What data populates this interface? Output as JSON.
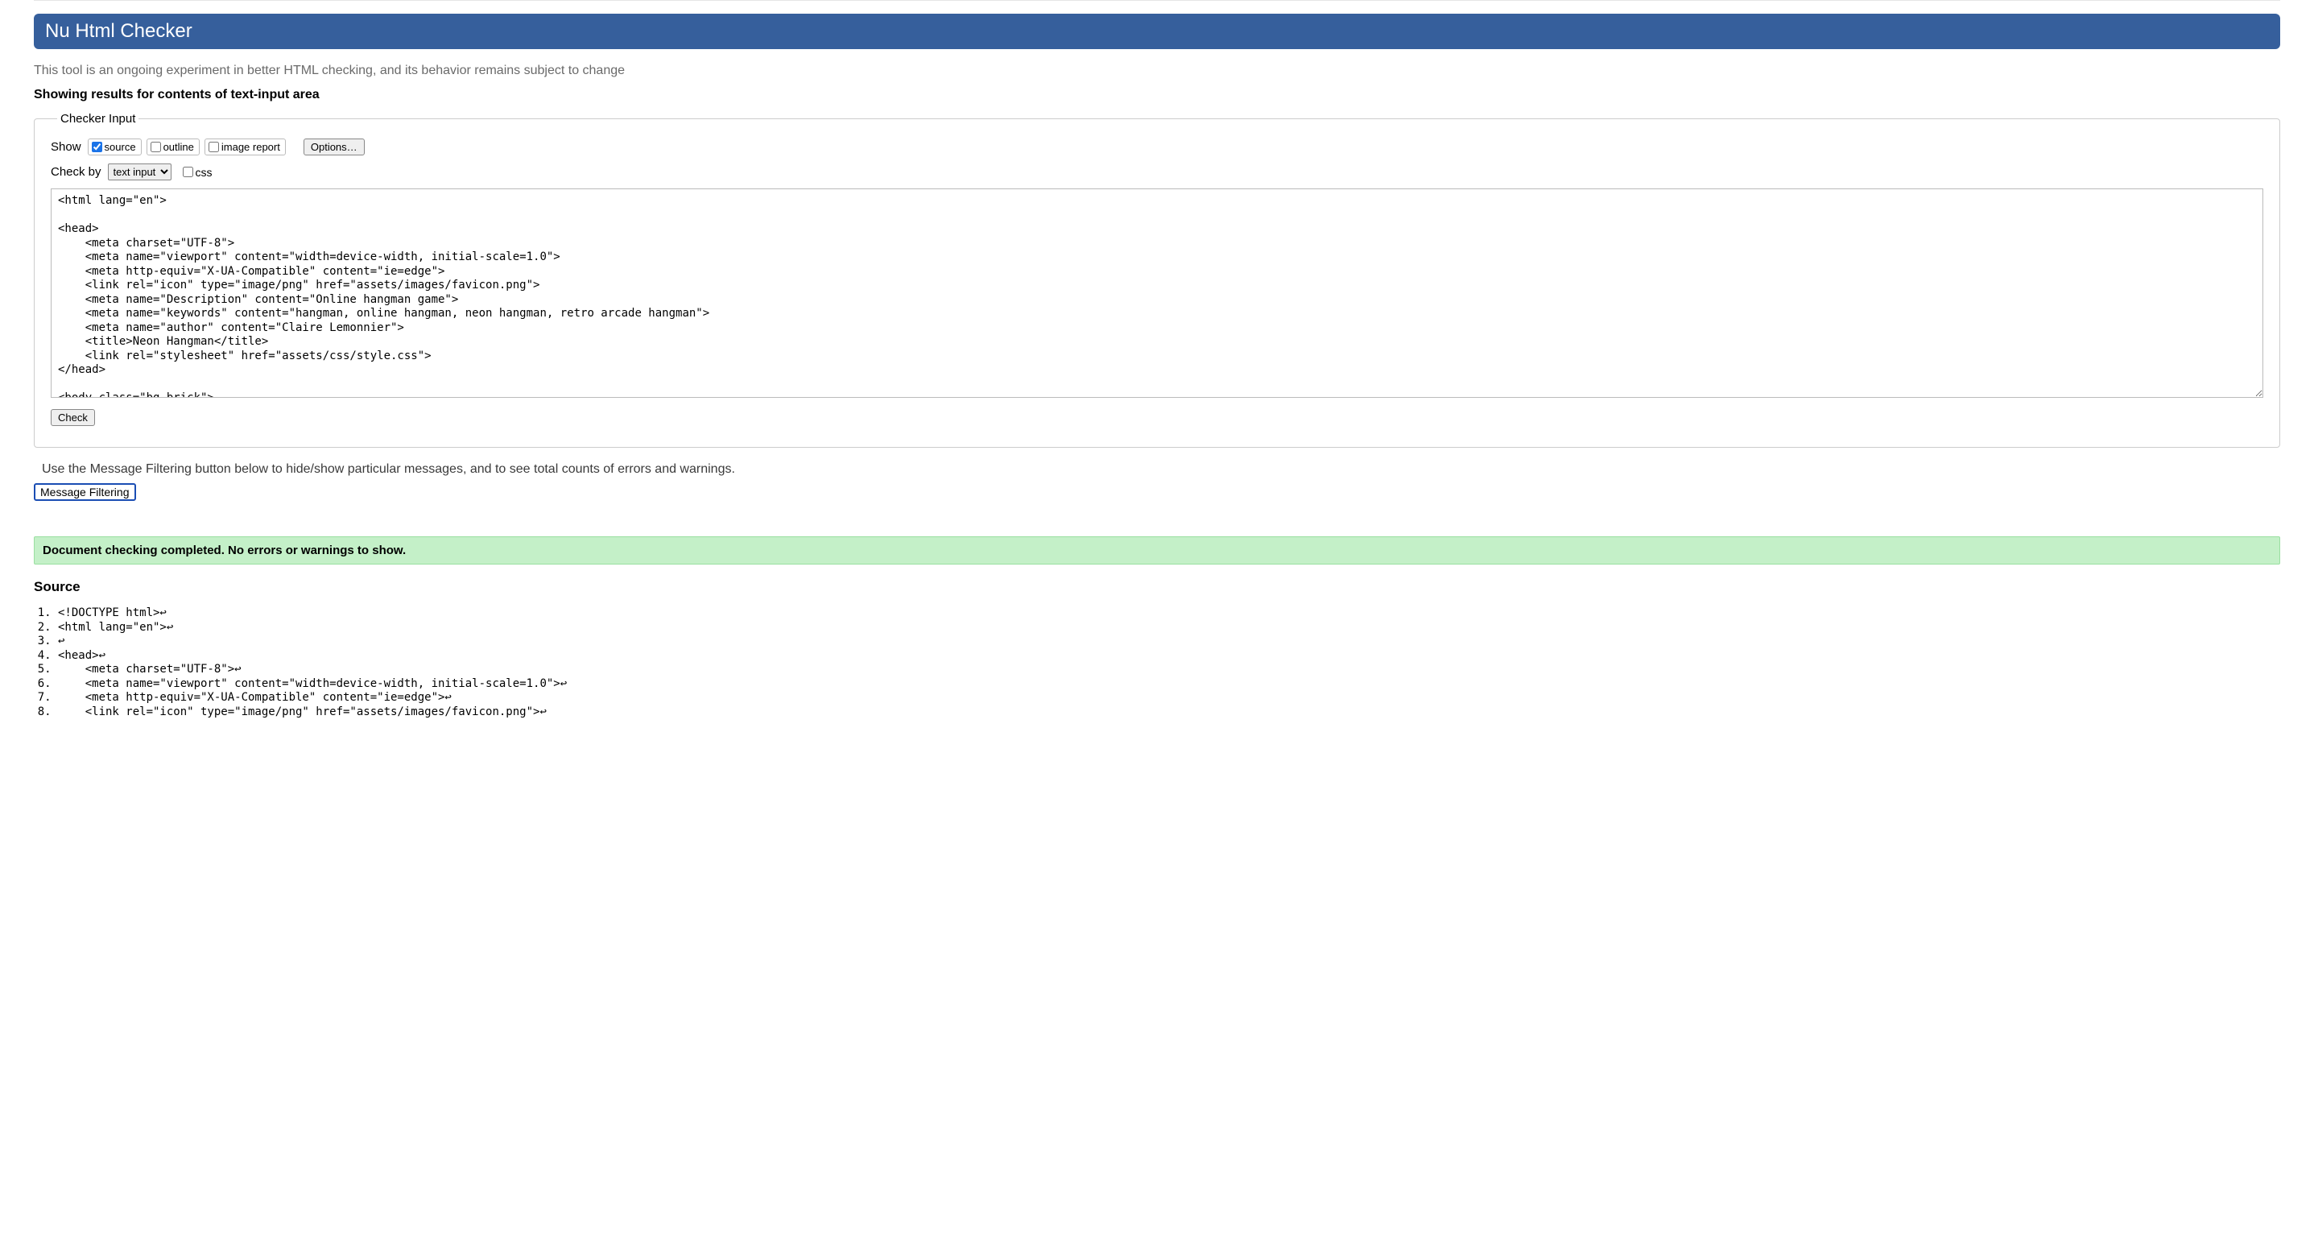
{
  "header": {
    "title": "Nu Html Checker"
  },
  "subtitle": "This tool is an ongoing experiment in better HTML checking, and its behavior remains subject to change",
  "results_heading": "Showing results for contents of text-input area",
  "checker": {
    "legend": "Checker Input",
    "show_label": "Show",
    "cb_source": "source",
    "cb_outline": "outline",
    "cb_image_report": "image report",
    "options_button": "Options…",
    "check_by_label": "Check by",
    "check_by_selected": "text input",
    "css_label": "css",
    "textarea_value": "<html lang=\"en\">\n\n<head>\n    <meta charset=\"UTF-8\">\n    <meta name=\"viewport\" content=\"width=device-width, initial-scale=1.0\">\n    <meta http-equiv=\"X-UA-Compatible\" content=\"ie=edge\">\n    <link rel=\"icon\" type=\"image/png\" href=\"assets/images/favicon.png\">\n    <meta name=\"Description\" content=\"Online hangman game\">\n    <meta name=\"keywords\" content=\"hangman, online hangman, neon hangman, retro arcade hangman\">\n    <meta name=\"author\" content=\"Claire Lemonnier\">\n    <title>Neon Hangman</title>\n    <link rel=\"stylesheet\" href=\"assets/css/style.css\">\n</head>\n\n<body class=\"bg-brick\">",
    "check_button": "Check"
  },
  "filter": {
    "note": "Use the Message Filtering button below to hide/show particular messages, and to see total counts of errors and warnings.",
    "button": "Message Filtering"
  },
  "success": "Document checking completed. No errors or warnings to show.",
  "source": {
    "heading": "Source",
    "lines": [
      "<!DOCTYPE html>↩",
      "<html lang=\"en\">↩",
      "↩",
      "<head>↩",
      "    <meta charset=\"UTF-8\">↩",
      "    <meta name=\"viewport\" content=\"width=device-width, initial-scale=1.0\">↩",
      "    <meta http-equiv=\"X-UA-Compatible\" content=\"ie=edge\">↩",
      "    <link rel=\"icon\" type=\"image/png\" href=\"assets/images/favicon.png\">↩"
    ]
  }
}
